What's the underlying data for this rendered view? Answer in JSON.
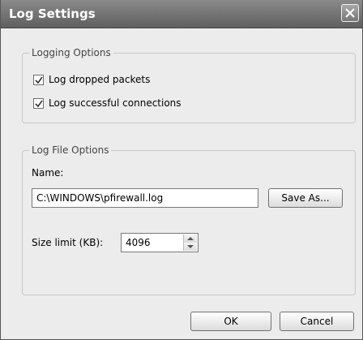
{
  "window": {
    "title": "Log Settings"
  },
  "logging_options": {
    "legend": "Logging Options",
    "dropped_packets": {
      "label": "Log dropped packets",
      "checked": true
    },
    "successful_connections": {
      "label": "Log successful connections",
      "checked": true
    }
  },
  "log_file_options": {
    "legend": "Log File Options",
    "name_label": "Name:",
    "name_value": "C:\\WINDOWS\\pfirewall.log",
    "save_as_label": "Save As...",
    "size_label": "Size limit (KB):",
    "size_value": "4096"
  },
  "buttons": {
    "ok": "OK",
    "cancel": "Cancel"
  }
}
